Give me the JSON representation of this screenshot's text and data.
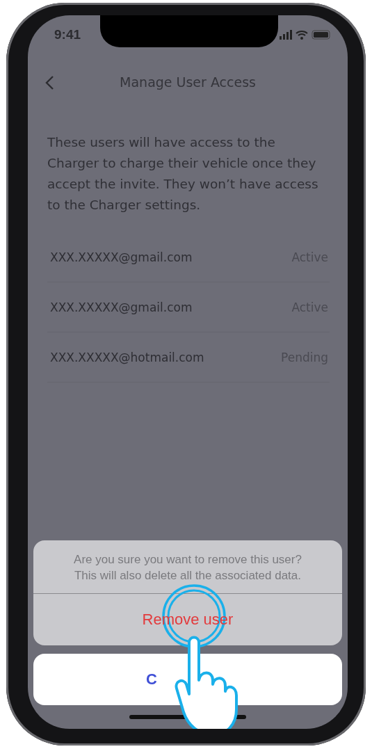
{
  "status_bar": {
    "time": "9:41"
  },
  "nav": {
    "title": "Manage User Access"
  },
  "description": "These users will have access to the Charger to charge their vehicle once they accept the invite. They won’t have access to the Charger settings.",
  "users": [
    {
      "email": "XXX.XXXXX@gmail.com",
      "status": "Active"
    },
    {
      "email": "XXX.XXXXX@gmail.com",
      "status": "Active"
    },
    {
      "email": "XXX.XXXXX@hotmail.com",
      "status": "Pending"
    }
  ],
  "action_sheet": {
    "message": "Are you sure you want to remove this user?\nThis will also delete all the associated data.",
    "actions": [
      {
        "label": "Remove user",
        "kind": "destructive"
      }
    ],
    "cancel": {
      "label": "C"
    }
  }
}
